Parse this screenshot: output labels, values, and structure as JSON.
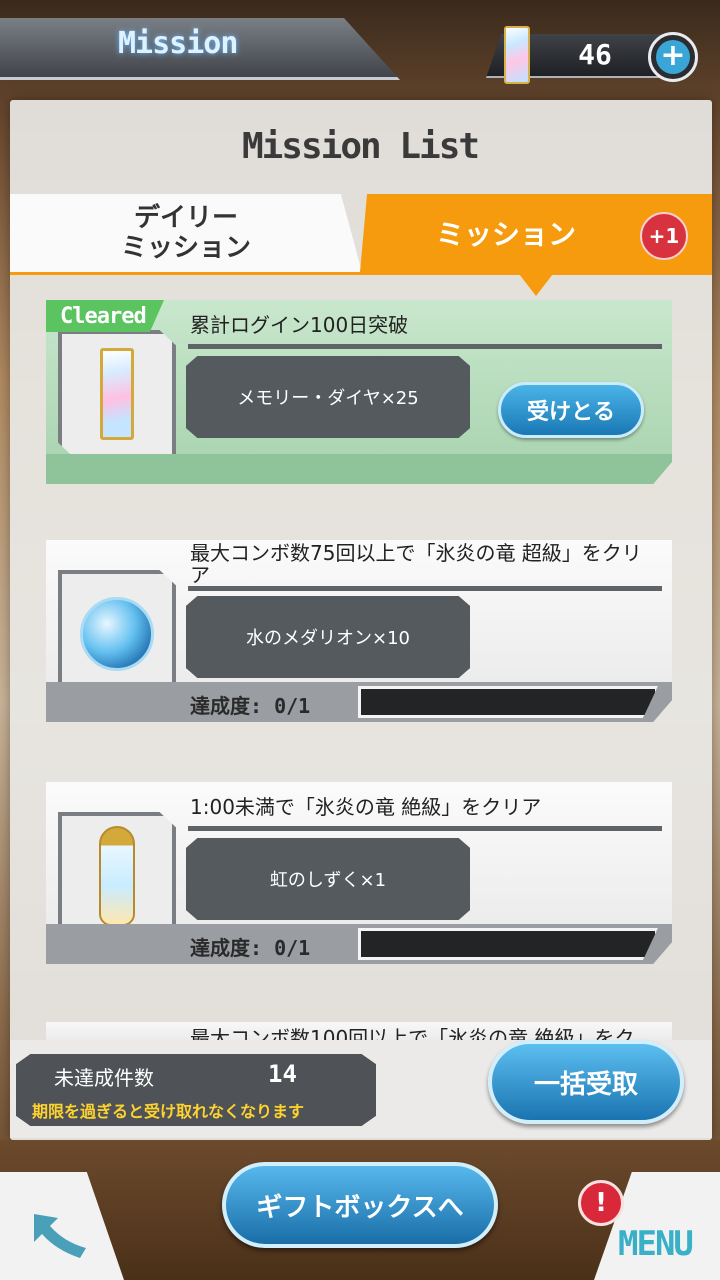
{
  "header": {
    "title": "Mission",
    "currency_value": "46",
    "add_icon": "plus-icon"
  },
  "panel": {
    "title": "Mission List",
    "tabs": [
      {
        "label": "デイリー\nミッション",
        "active": false
      },
      {
        "label": "ミッション",
        "active": true,
        "badge": "+1"
      }
    ]
  },
  "missions": [
    {
      "status": "Cleared",
      "title": "累計ログイン100日突破",
      "reward": "メモリー・ダイヤ×25",
      "claim_label": "受けとる",
      "icon": "memory-diamond-icon"
    },
    {
      "title": "最大コンボ数75回以上で「氷炎の竜 超級」をクリア",
      "reward": "水のメダリオン×10",
      "progress_label": "達成度: 0/1",
      "progress_fraction": 0,
      "icon": "water-medallion-icon"
    },
    {
      "title": "1:00未満で「氷炎の竜 絶級」をクリア",
      "reward": "虹のしずく×1",
      "progress_label": "達成度: 0/1",
      "progress_fraction": 0,
      "icon": "rainbow-drop-icon"
    },
    {
      "title": "最大コンボ数100回以上で「氷炎の竜 絶級」をク"
    }
  ],
  "footer": {
    "pending_label": "未達成件数",
    "pending_count": "14",
    "warning": "期限を過ぎると受け取れなくなります",
    "bulk_claim_label": "一括受取"
  },
  "nav": {
    "gift_box_label": "ギフトボックスへ",
    "menu_label": "MENU",
    "alert_mark": "!"
  },
  "colors": {
    "accent_orange": "#f59b0d",
    "button_blue": "#1a78b4",
    "cleared_green": "#5bc360",
    "alert_red": "#d8283a"
  }
}
